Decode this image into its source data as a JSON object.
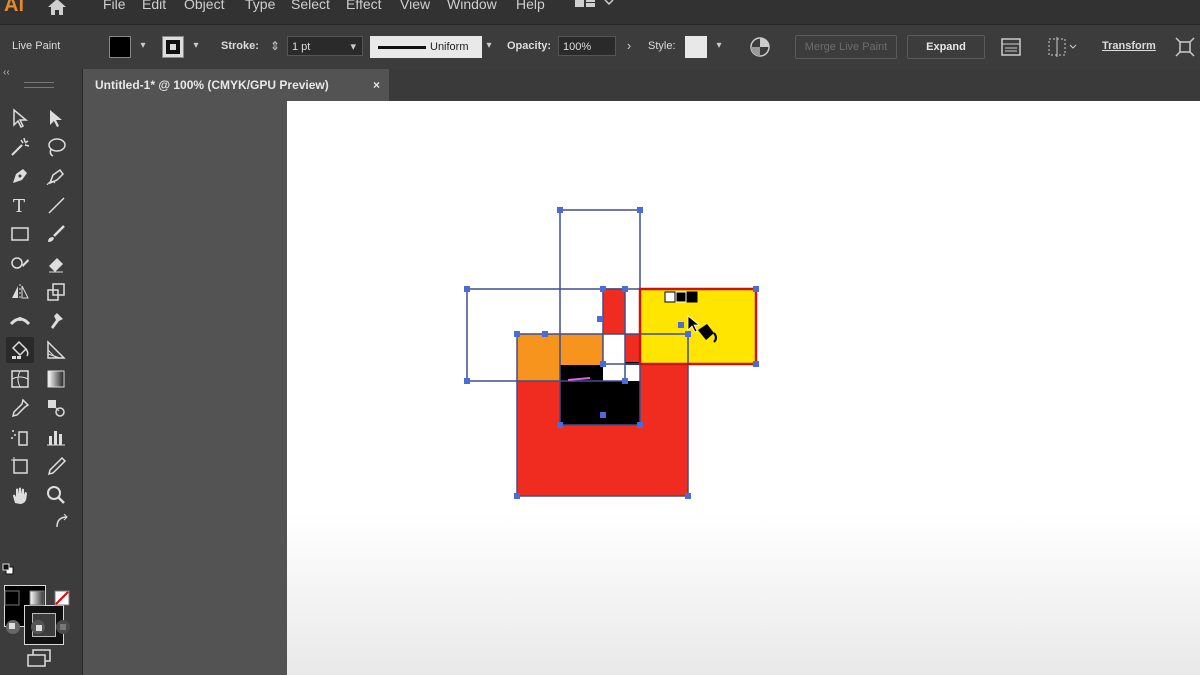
{
  "app": {
    "logo": "Ai"
  },
  "menu": {
    "items": [
      "File",
      "Edit",
      "Object",
      "Type",
      "Select",
      "Effect",
      "View",
      "Window",
      "Help"
    ]
  },
  "control_bar": {
    "mode_label": "Live Paint",
    "stroke_label": "Stroke:",
    "stroke_weight": "1 pt",
    "stroke_profile": "Uniform",
    "opacity_label": "Opacity:",
    "opacity_value": "100%",
    "style_label": "Style:",
    "merge_label": "Merge Live Paint",
    "expand_label": "Expand",
    "transform_label": "Transform"
  },
  "document_tab": {
    "title": "Untitled-1* @ 100% (CMYK/GPU Preview)",
    "close": "×"
  },
  "tools": [
    "selection-tool",
    "direct-selection-tool",
    "magic-wand-tool",
    "lasso-tool",
    "pen-tool",
    "curvature-tool",
    "type-tool",
    "line-segment-tool",
    "rectangle-tool",
    "paintbrush-tool",
    "shaper-tool",
    "eraser-tool",
    "rotate-tool",
    "scale-tool",
    "width-tool",
    "puppet-warp-tool",
    "live-paint-bucket-tool",
    "perspective-grid-tool",
    "mesh-tool",
    "gradient-tool",
    "eyedropper-tool",
    "blend-tool",
    "symbol-sprayer-tool",
    "column-graph-tool",
    "artboard-tool",
    "slice-tool",
    "hand-tool",
    "zoom-tool"
  ],
  "active_tool": "live-paint-bucket-tool",
  "colors": {
    "red": "#f02b20",
    "orange": "#f7941d",
    "yellow": "#ffe500",
    "black": "#000000",
    "selection_blue": "#4a6bd8",
    "path_blue": "#3d4f8f",
    "highlight_red": "#c81414"
  }
}
